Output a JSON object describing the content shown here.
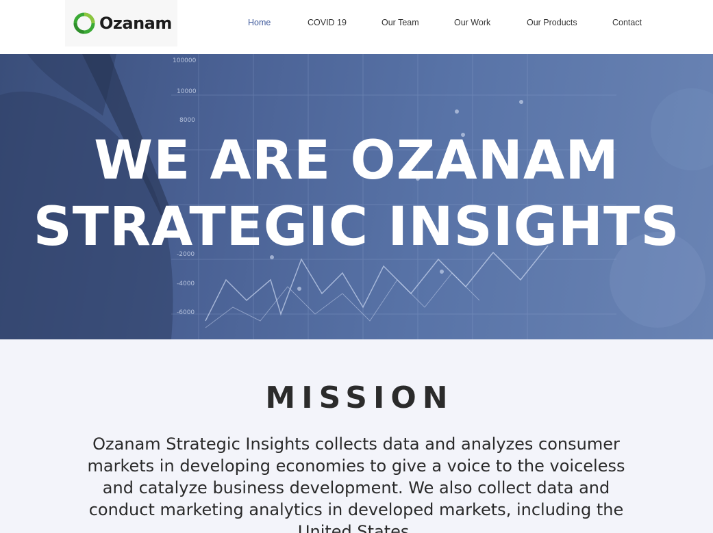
{
  "brand": {
    "name": "Ozanam",
    "colors": {
      "logo_green": "#3aa935",
      "logo_light_green": "#8cc63f",
      "nav_active": "#3f5a9c",
      "hero_blue": "#4a6194",
      "mission_bg": "#f3f4fa"
    }
  },
  "nav": {
    "items": [
      {
        "label": "Home",
        "active": true
      },
      {
        "label": "COVID 19",
        "active": false
      },
      {
        "label": "Our Team",
        "active": false
      },
      {
        "label": "Our Work",
        "active": false
      },
      {
        "label": "Our Products",
        "active": false
      },
      {
        "label": "Contact",
        "active": false
      }
    ]
  },
  "hero": {
    "title_line1": "WE ARE OZANAM",
    "title_line2": "STRATEGIC INSIGHTS",
    "background_axis_labels": [
      "100000",
      "10000",
      "8000",
      "-2000",
      "-4000",
      "-6000"
    ]
  },
  "mission": {
    "heading": "MISSION",
    "body": "Ozanam Strategic Insights collects data and analyzes consumer markets in developing economies to give a voice to the voiceless and catalyze business development. We also collect data and conduct marketing analytics in developed markets, including the United States."
  }
}
